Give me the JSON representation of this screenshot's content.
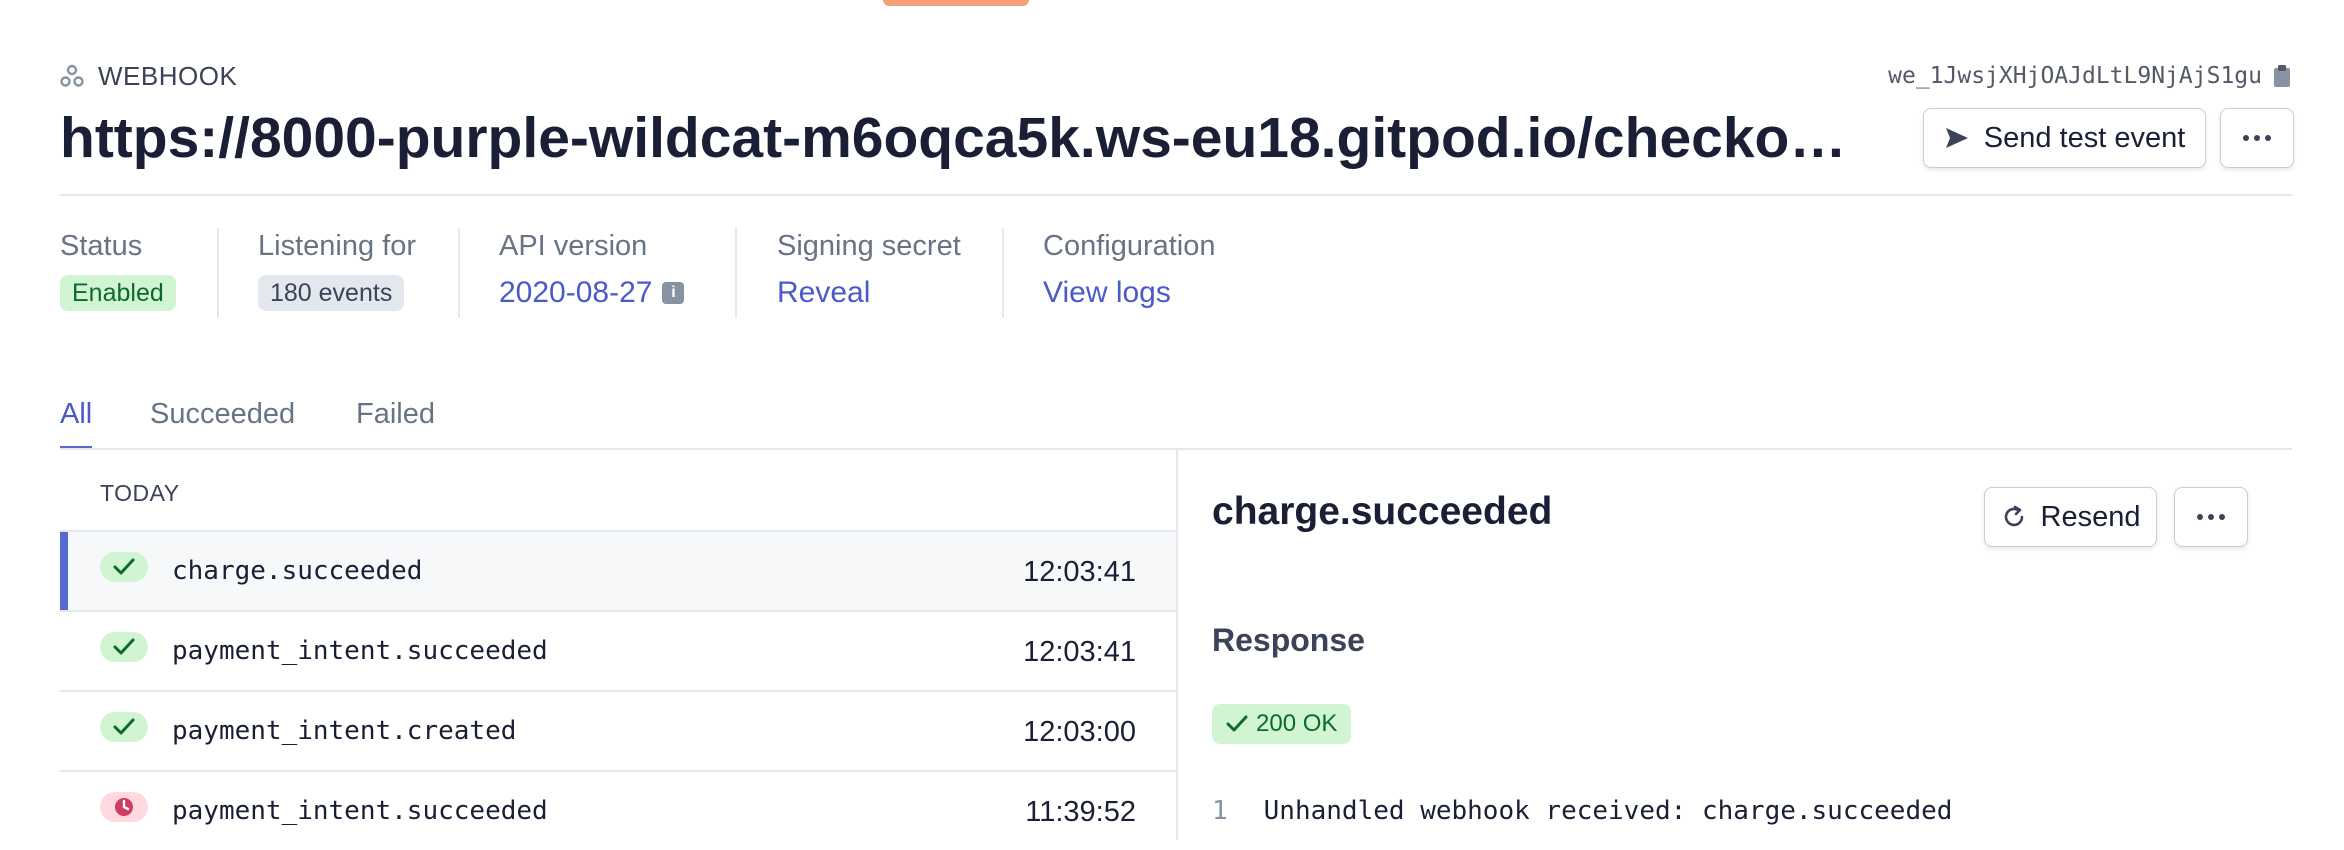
{
  "header": {
    "kicker": "WEBHOOK",
    "endpoint_id": "we_1JwsjXHjOAJdLtL9NjAjS1gu",
    "url": "https://8000-purple-wildcat-m6oqca5k.ws-eu18.gitpod.io/checko…",
    "send_test_label": "Send test event"
  },
  "meta": {
    "status_label": "Status",
    "status_value": "Enabled",
    "listening_label": "Listening for",
    "listening_value": "180 events",
    "api_label": "API version",
    "api_value": "2020-08-27",
    "secret_label": "Signing secret",
    "secret_value": "Reveal",
    "config_label": "Configuration",
    "config_value": "View logs"
  },
  "tabs": [
    {
      "label": "All",
      "active": true
    },
    {
      "label": "Succeeded",
      "active": false
    },
    {
      "label": "Failed",
      "active": false
    }
  ],
  "list": {
    "group_label": "TODAY",
    "rows": [
      {
        "event": "charge.succeeded",
        "time": "12:03:41",
        "status": "succeeded",
        "selected": true
      },
      {
        "event": "payment_intent.succeeded",
        "time": "12:03:41",
        "status": "succeeded",
        "selected": false
      },
      {
        "event": "payment_intent.created",
        "time": "12:03:00",
        "status": "succeeded",
        "selected": false
      },
      {
        "event": "payment_intent.succeeded",
        "time": "11:39:52",
        "status": "pending",
        "selected": false
      }
    ]
  },
  "detail": {
    "title": "charge.succeeded",
    "resend_label": "Resend",
    "response_label": "Response",
    "status_badge": "200 OK",
    "lines": [
      {
        "no": "1",
        "text": "Unhandled webhook received: charge.succeeded"
      }
    ]
  },
  "colors": {
    "accent": "#5469d4",
    "link": "#4a5ac9",
    "success_bg": "#d1f5d3",
    "success_fg": "#0d6a2d",
    "pending_bg": "#ffd9df",
    "pending_fg": "#cd3d64"
  }
}
